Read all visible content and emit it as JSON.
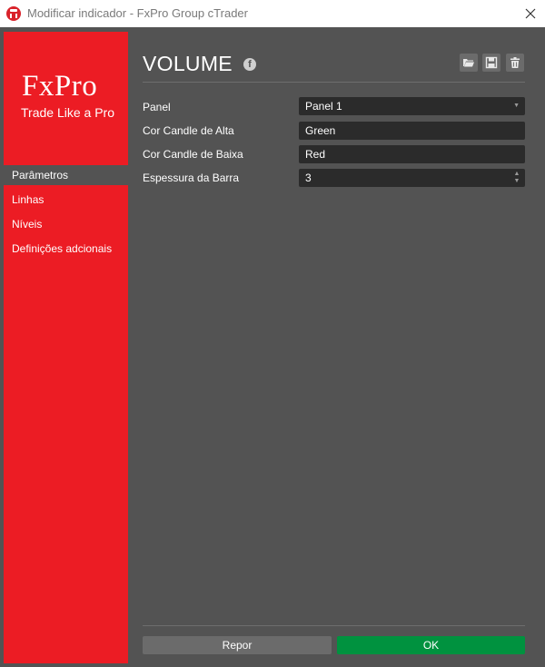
{
  "window": {
    "title": "Modificar indicador - FxPro Group cTrader"
  },
  "sidebar": {
    "brand": "FxPro",
    "tagline": "Trade Like a Pro",
    "items": [
      {
        "label": "Parâmetros",
        "active": true
      },
      {
        "label": "Linhas",
        "active": false
      },
      {
        "label": "Níveis",
        "active": false
      },
      {
        "label": "Definições adcionais",
        "active": false
      }
    ]
  },
  "header": {
    "title": "VOLUME",
    "social_icon": "facebook-icon"
  },
  "toolbar": {
    "icons": [
      "folder-open-icon",
      "save-icon",
      "trash-icon"
    ]
  },
  "parameters": [
    {
      "label": "Panel",
      "value": "Panel 1",
      "control": "dropdown"
    },
    {
      "label": "Cor Candle de Alta",
      "value": "Green",
      "control": "text"
    },
    {
      "label": "Cor Candle de Baixa",
      "value": "Red",
      "control": "text"
    },
    {
      "label": "Espessura da Barra",
      "value": "3",
      "control": "spinner"
    }
  ],
  "footer": {
    "reset_label": "Repor",
    "ok_label": "OK"
  },
  "colors": {
    "sidebar_bg": "#ec1c24",
    "panel_bg": "#535353",
    "field_bg": "#2b2b2b",
    "ok_button": "#00923f",
    "reset_button": "#6b6b6b"
  }
}
